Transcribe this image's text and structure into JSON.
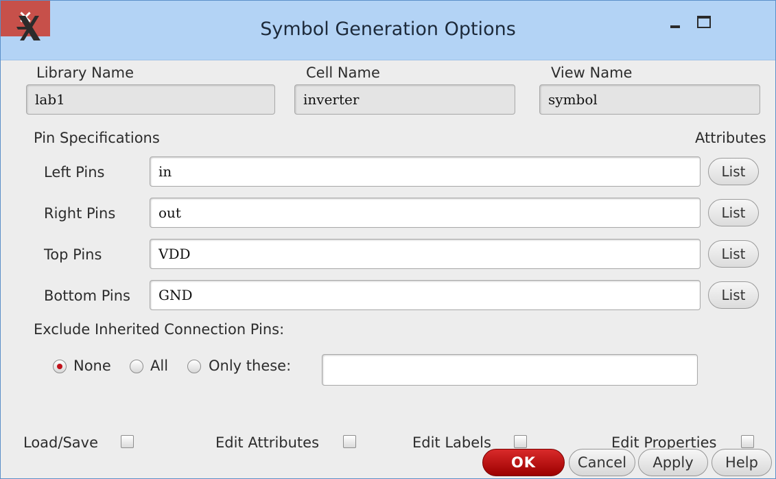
{
  "window": {
    "title": "Symbol Generation Options",
    "close_glyph": "×"
  },
  "names": {
    "library_label": "Library Name",
    "library_value": "lab1",
    "cell_label": "Cell Name",
    "cell_value": "inverter",
    "view_label": "View Name",
    "view_value": "symbol"
  },
  "pins": {
    "section_label": "Pin Specifications",
    "attributes_label": "Attributes",
    "rows": [
      {
        "label": "Left Pins",
        "value": "in",
        "button": "List"
      },
      {
        "label": "Right Pins",
        "value": "out",
        "button": "List"
      },
      {
        "label": "Top Pins",
        "value": "VDD",
        "button": "List"
      },
      {
        "label": "Bottom Pins",
        "value": "GND",
        "button": "List"
      }
    ]
  },
  "exclude": {
    "label": "Exclude Inherited Connection Pins:",
    "options": [
      "None",
      "All",
      "Only these:"
    ],
    "selected": "None",
    "only_these_value": ""
  },
  "checkboxes": [
    {
      "label": "Load/Save",
      "checked": false
    },
    {
      "label": "Edit Attributes",
      "checked": false
    },
    {
      "label": "Edit Labels",
      "checked": false
    },
    {
      "label": "Edit Properties",
      "checked": false
    }
  ],
  "buttons": {
    "ok": "OK",
    "cancel": "Cancel",
    "apply": "Apply",
    "help": "Help"
  },
  "colors": {
    "titlebar": "#b3d3f5",
    "close": "#c7504a",
    "ok": "#b50a0a",
    "radio_selected": "#c0121b"
  }
}
